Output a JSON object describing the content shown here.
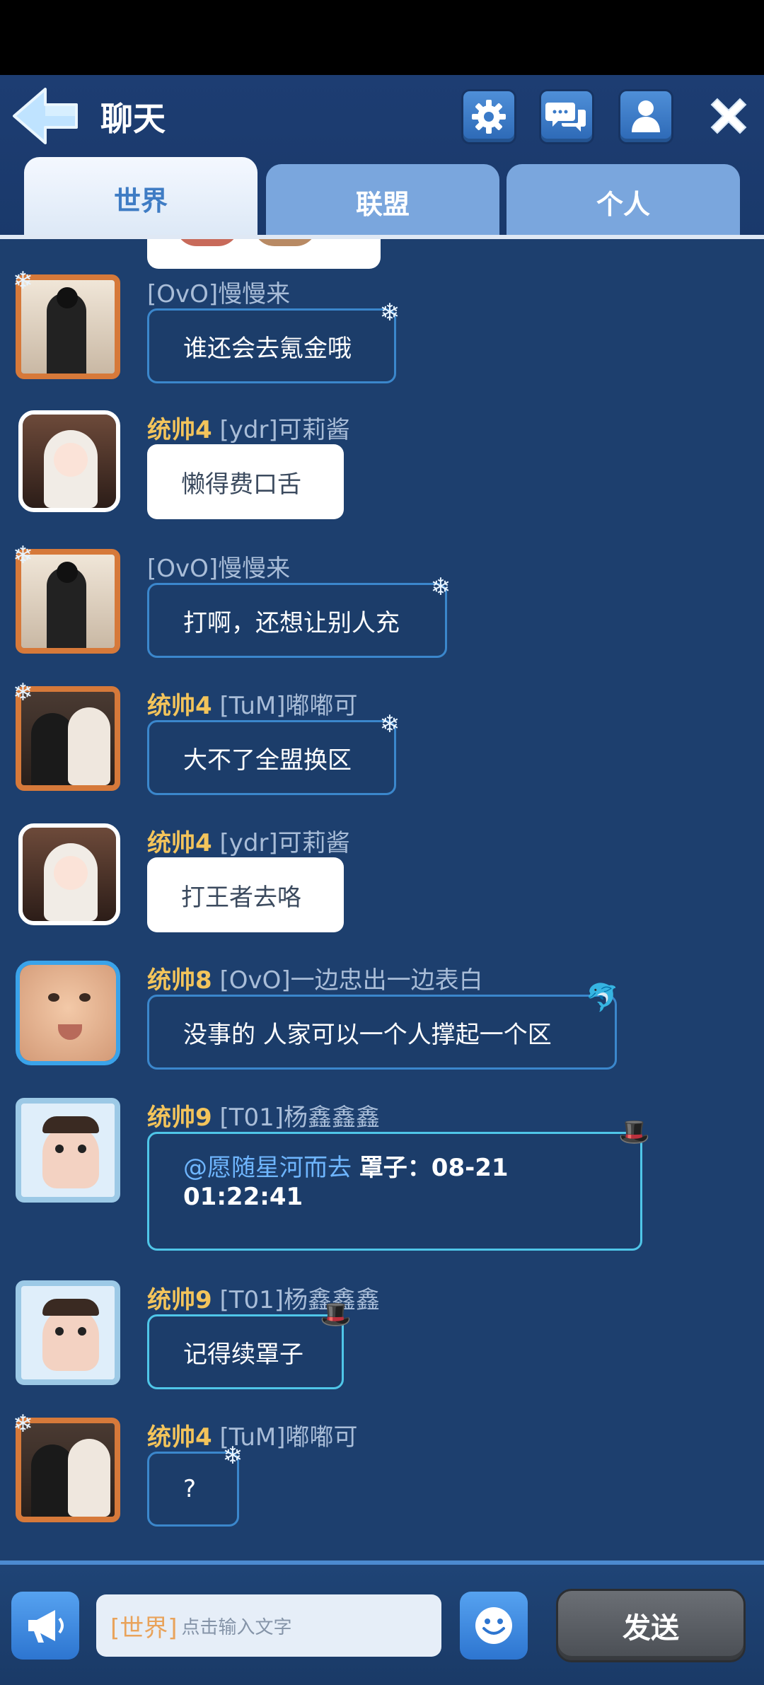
{
  "header": {
    "title": "聊天",
    "icons": {
      "back": "back-arrow-icon",
      "settings": "gear-icon",
      "chat": "chat-bubbles-icon",
      "profile": "person-icon",
      "close": "close-icon"
    }
  },
  "tabs": [
    {
      "label": "世界",
      "active": true
    },
    {
      "label": "联盟",
      "active": false
    },
    {
      "label": "个人",
      "active": false
    }
  ],
  "messages": [
    {
      "rank": "",
      "tag": "[OvO]",
      "name": "慢慢来",
      "text": "谁还会去氪金哦"
    },
    {
      "rank": "统帅4",
      "tag": "[ydr]",
      "name": "可莉酱",
      "text": "懒得费口舌"
    },
    {
      "rank": "",
      "tag": "[OvO]",
      "name": "慢慢来",
      "text": "打啊，还想让别人充"
    },
    {
      "rank": "统帅4",
      "tag": "[TuM]",
      "name": "嘟嘟可",
      "text": "大不了全盟换区"
    },
    {
      "rank": "统帅4",
      "tag": "[ydr]",
      "name": "可莉酱",
      "text": "打王者去咯"
    },
    {
      "rank": "统帅8",
      "tag": "[OvO]",
      "name": "一边忠出一边表白",
      "text": "没事的  人家可以一个人撑起一个区"
    },
    {
      "rank": "统帅9",
      "tag": "[T01]",
      "name": "杨鑫鑫鑫",
      "mention": "@愿随星河而去",
      "text_line1": "罩子：08-21",
      "text_line2": "01:22:41"
    },
    {
      "rank": "统帅9",
      "tag": "[T01]",
      "name": "杨鑫鑫鑫",
      "text": "记得续罩子"
    },
    {
      "rank": "统帅4",
      "tag": "[TuM]",
      "name": "嘟嘟可",
      "text": "?"
    }
  ],
  "input": {
    "channel": "[世界]",
    "placeholder": "点击输入文字"
  },
  "send_label": "发送",
  "colors": {
    "background": "#1d3f6e",
    "rank": "#f3c45b",
    "name": "#a9bdd8",
    "mention": "#6fb6ff",
    "accent": "#3b87cc"
  }
}
